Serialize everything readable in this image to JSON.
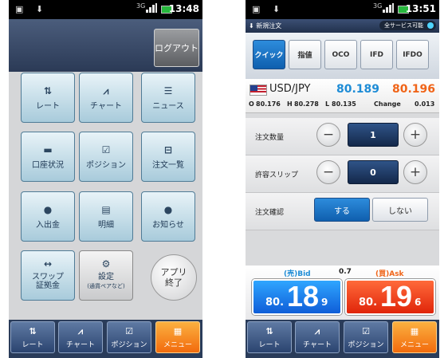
{
  "left_screen": {
    "status_bar": {
      "icons": [
        "image-icon",
        "download-icon"
      ],
      "signal": "3G",
      "time": "13:48"
    },
    "header": {
      "logout_label": "ログアウト"
    },
    "menu": [
      {
        "label": "レート",
        "icon": "rate-arrows-icon",
        "glyph": "⇅"
      },
      {
        "label": "チャート",
        "icon": "chart-icon",
        "glyph": "⩘"
      },
      {
        "label": "ニュース",
        "icon": "news-icon",
        "glyph": "☰"
      },
      {
        "label": "口座状況",
        "icon": "account-card-icon",
        "glyph": "▬"
      },
      {
        "label": "ポジション",
        "icon": "position-check-icon",
        "glyph": "☑"
      },
      {
        "label": "注文一覧",
        "icon": "order-list-icon",
        "glyph": "⊟"
      },
      {
        "label": "入出金",
        "icon": "money-bag-icon",
        "glyph": "●"
      },
      {
        "label": "明細",
        "icon": "statement-icon",
        "glyph": "▤"
      },
      {
        "label": "お知らせ",
        "icon": "notice-icon",
        "glyph": "●"
      },
      {
        "label": "スワップ\n証拠金",
        "icon": "swap-arrows-icon",
        "glyph": "↔"
      }
    ],
    "settings": {
      "label": "設定",
      "sublabel": "(通貨ペアなど)",
      "icon": "gear-icon",
      "glyph": "⚙"
    },
    "exit": {
      "line1": "アプリ",
      "line2": "終了"
    },
    "tabs": [
      {
        "label": "レート",
        "icon": "rate-arrows-icon",
        "glyph": "⇅",
        "active": false
      },
      {
        "label": "チャート",
        "icon": "chart-icon",
        "glyph": "⩘",
        "active": false
      },
      {
        "label": "ポジション",
        "icon": "position-check-icon",
        "glyph": "☑",
        "active": false
      },
      {
        "label": "メニュー",
        "icon": "menu-grid-icon",
        "glyph": "▦",
        "active": true
      }
    ]
  },
  "right_screen": {
    "status_bar": {
      "icons": [
        "image-icon",
        "download-icon"
      ],
      "signal": "3G",
      "time": "13:51"
    },
    "order_header": {
      "title": "新規注文",
      "icon": "down-arrow-icon",
      "service_status": "全サービス可能",
      "status_color": "#4fd4ff"
    },
    "order_types": [
      {
        "label": "クイック",
        "active": true
      },
      {
        "label": "指値",
        "active": false
      },
      {
        "label": "OCO",
        "active": false
      },
      {
        "label": "IFD",
        "active": false
      },
      {
        "label": "IFDO",
        "active": false
      }
    ],
    "quote": {
      "pair": "USD/JPY",
      "bid": "80.189",
      "ask": "80.196",
      "open_label": "O",
      "open": "80.176",
      "high_label": "H",
      "high": "80.278",
      "low_label": "L",
      "low": "80.135",
      "change_label": "Change",
      "change": "0.013"
    },
    "quantity": {
      "label": "注文数量",
      "value": "1",
      "minus": "−",
      "plus": "+"
    },
    "slippage": {
      "label": "許容スリップ",
      "value": "0",
      "minus": "−",
      "plus": "+"
    },
    "confirm": {
      "label": "注文確認",
      "yes": "する",
      "no": "しない",
      "selected": "yes"
    },
    "prices": {
      "bid_label": "(売)Bid",
      "spread": "0.7",
      "ask_label": "(買)Ask",
      "bid_prefix": "80.",
      "bid_big": "18",
      "bid_pip": "9",
      "ask_prefix": "80.",
      "ask_big": "19",
      "ask_pip": "6"
    },
    "tabs": [
      {
        "label": "レート",
        "icon": "rate-arrows-icon",
        "glyph": "⇅",
        "active": false
      },
      {
        "label": "チャート",
        "icon": "chart-icon",
        "glyph": "⩘",
        "active": false
      },
      {
        "label": "ポジション",
        "icon": "position-check-icon",
        "glyph": "☑",
        "active": false
      },
      {
        "label": "メニュー",
        "icon": "menu-grid-icon",
        "glyph": "▦",
        "active": true
      }
    ]
  },
  "colors": {
    "bid": "#1e8cd6",
    "ask": "#f06418",
    "active_tab": "#f68a1f",
    "header": "#2b3a56"
  }
}
